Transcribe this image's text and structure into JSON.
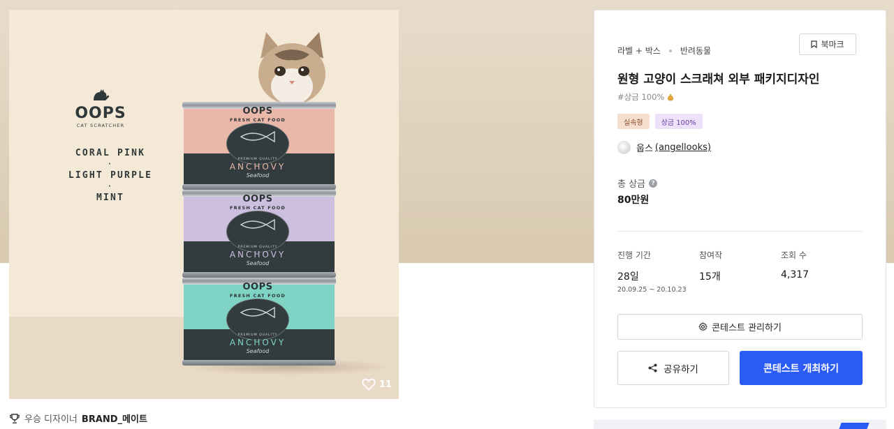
{
  "product_image": {
    "brand": "OOPS",
    "brand_sub": "CAT SCRATCHER",
    "colors": [
      "CORAL PINK",
      "LIGHT PURPLE",
      "MINT"
    ],
    "color_separator": "·",
    "cans": [
      {
        "color": "#e9b8a9",
        "label": "OOPS",
        "line": "FRESH CAT FOOD",
        "premium": "PREMIUM QUALITY",
        "flavor": "ANCHOVY",
        "type": "Seafood",
        "flavor_color": "#e9b8a9"
      },
      {
        "color": "#cdbfe0",
        "label": "OOPS",
        "line": "FRESH CAT FOOD",
        "premium": "PREMIUM QUALITY",
        "flavor": "ANCHOVY",
        "type": "Seafood",
        "flavor_color": "#cdbfe0"
      },
      {
        "color": "#7fd3c4",
        "label": "OOPS",
        "line": "FRESH CAT FOOD",
        "premium": "PREMIUM QUALITY",
        "flavor": "ANCHOVY",
        "type": "Seafood",
        "flavor_color": "#7fd3c4"
      }
    ],
    "like_icon": "heart-icon",
    "like_count": "11"
  },
  "winner": {
    "icon": "trophy-icon",
    "label": "우승 디자이너",
    "name": "BRAND_메이트"
  },
  "contest": {
    "breadcrumb": [
      "라벨 + 박스",
      "반려동물"
    ],
    "bookmark_label": "북마크",
    "title": "원형 고양이 스크래쳐 외부 패키지디자인",
    "tagline": "#상금 100%",
    "badges": [
      "실속형",
      "상금 100%"
    ],
    "owner_name": "웁스",
    "owner_handle": "(angellooks)",
    "prize_label": "총 상금",
    "prize_help": "?",
    "prize_value": "80만원",
    "stats": {
      "period_label": "진행 기간",
      "period_value": "28일",
      "period_range": "20.09.25 ~ 20.10.23",
      "entries_label": "참여작",
      "entries_value": "15개",
      "views_label": "조회 수",
      "views_value": "4,317"
    },
    "manage_label": "콘테스트 관리하기",
    "share_label": "공유하기",
    "host_label": "콘테스트 개최하기"
  },
  "colors": {
    "accent": "#2a5cf5",
    "hero_bg": "#ddd0bb"
  }
}
